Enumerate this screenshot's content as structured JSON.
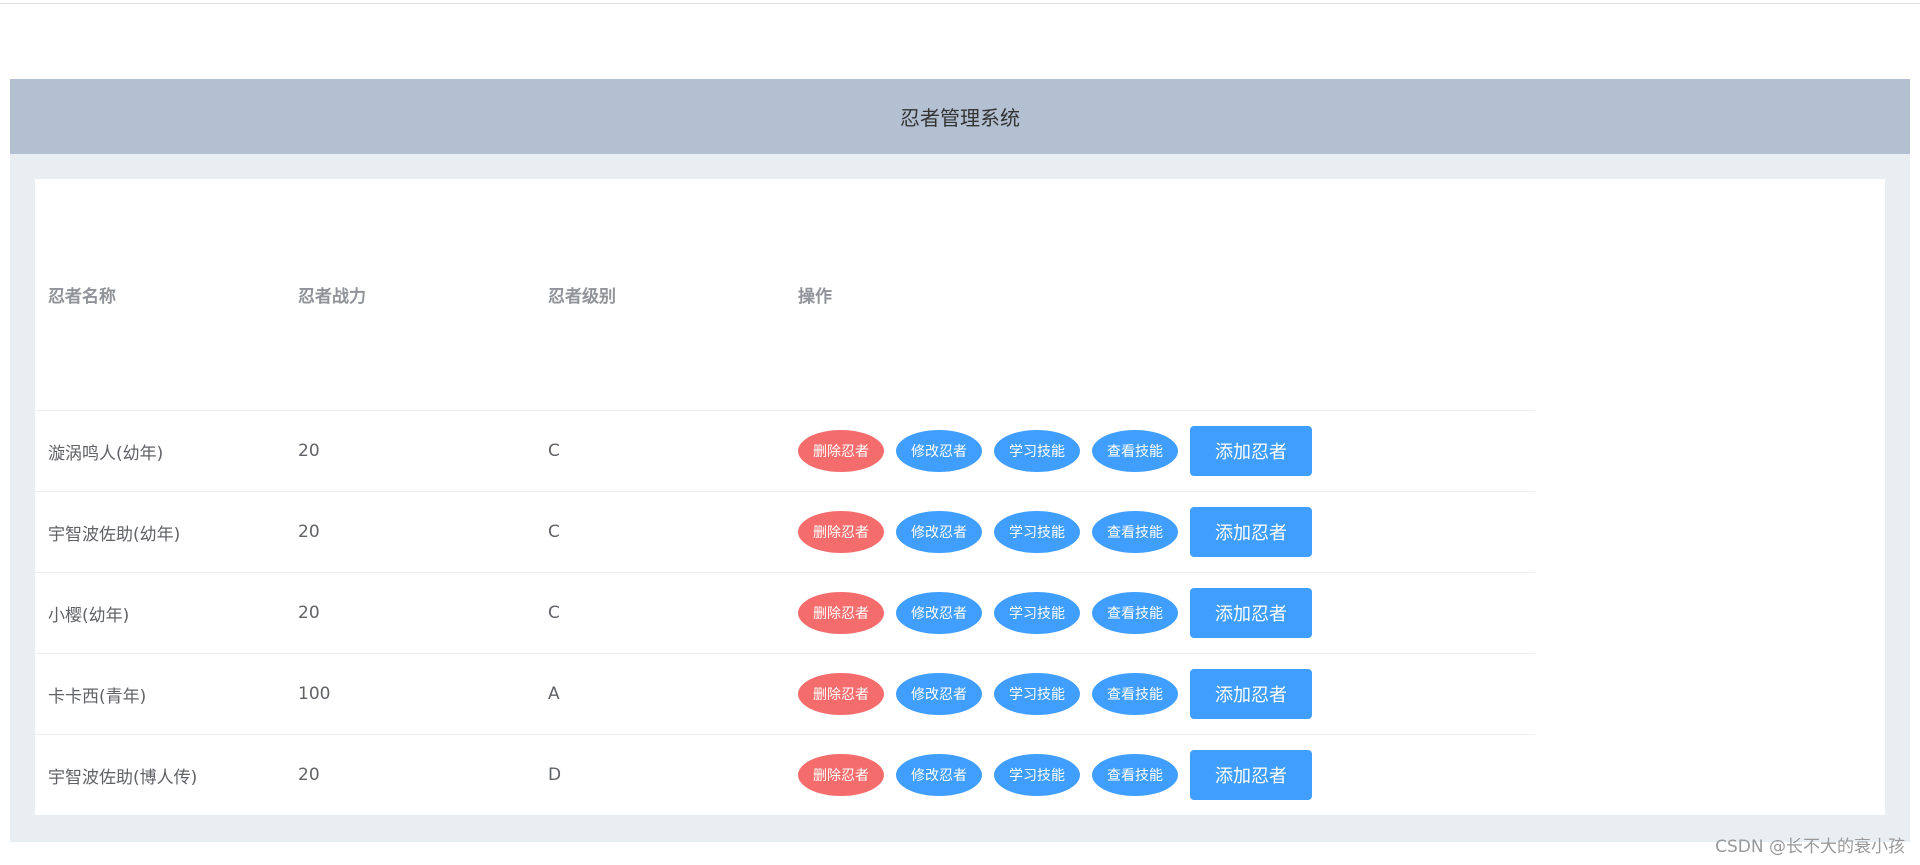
{
  "header": {
    "title": "忍者管理系统"
  },
  "table": {
    "columns": [
      "忍者名称",
      "忍者战力",
      "忍者级别",
      "操作"
    ],
    "rows": [
      {
        "name": "漩涡鸣人(幼年)",
        "power": "20",
        "level": "C"
      },
      {
        "name": "宇智波佐助(幼年)",
        "power": "20",
        "level": "C"
      },
      {
        "name": "小樱(幼年)",
        "power": "20",
        "level": "C"
      },
      {
        "name": "卡卡西(青年)",
        "power": "100",
        "level": "A"
      },
      {
        "name": "宇智波佐助(博人传)",
        "power": "20",
        "level": "D"
      }
    ]
  },
  "actions": {
    "delete_label": "删除忍者",
    "edit_label": "修改忍者",
    "learn_label": "学习技能",
    "view_label": "查看技能",
    "add_label": "添加忍者"
  },
  "colors": {
    "header_bg": "#b3c0d1",
    "frame_bg": "#e9eef3",
    "danger": "#f56c6c",
    "primary": "#409eff"
  },
  "watermark": "CSDN @长不大的衰小孩"
}
